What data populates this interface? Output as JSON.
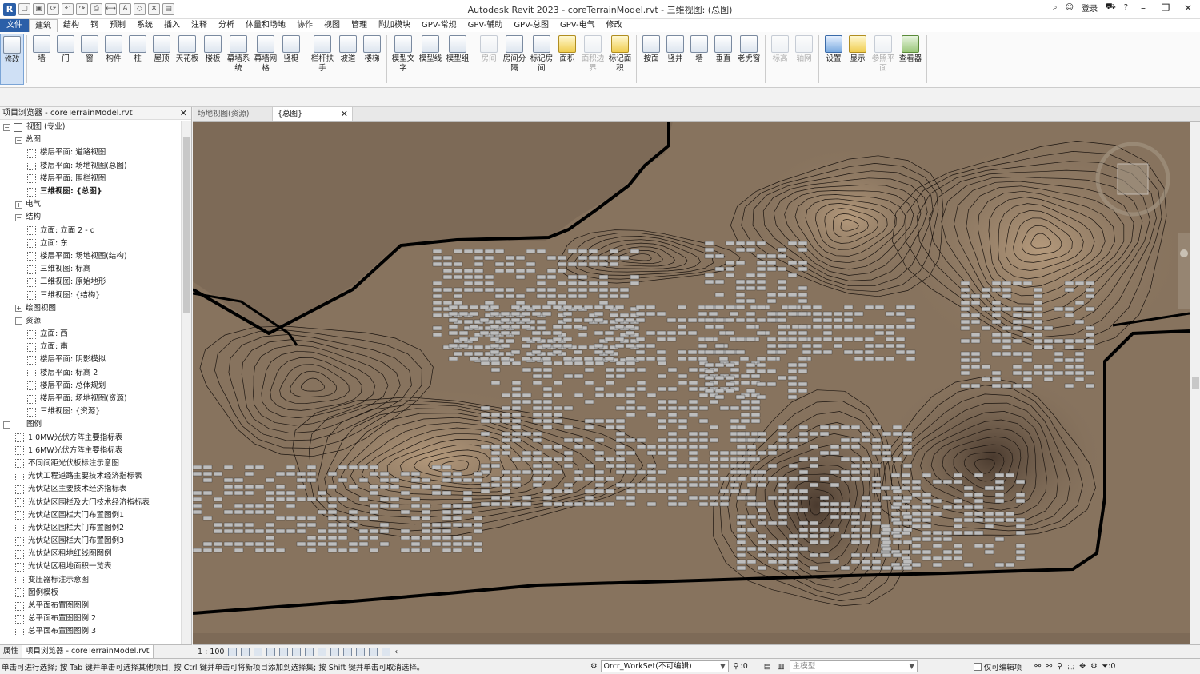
{
  "title": "Autodesk Revit 2023 - coreTerrainModel.rvt - 三维视图: (总图)",
  "title_right": {
    "login": "登录",
    "help": "?"
  },
  "menu_tabs": [
    "文件",
    "建筑",
    "结构",
    "钢",
    "预制",
    "系统",
    "插入",
    "注释",
    "分析",
    "体量和场地",
    "协作",
    "视图",
    "管理",
    "附加模块",
    "GPV-常规",
    "GPV-辅助",
    "GPV-总图",
    "GPV-电气",
    "修改"
  ],
  "ribbon": {
    "buttons": [
      {
        "label": "修改",
        "icon": "cursor-icon",
        "style": "sel"
      },
      {
        "label": "墙",
        "icon": "wall-icon"
      },
      {
        "label": "门",
        "icon": "door-icon"
      },
      {
        "label": "窗",
        "icon": "window-icon"
      },
      {
        "label": "构件",
        "icon": "component-icon"
      },
      {
        "label": "柱",
        "icon": "column-icon"
      },
      {
        "label": "屋顶",
        "icon": "roof-icon"
      },
      {
        "label": "天花板",
        "icon": "ceiling-icon"
      },
      {
        "label": "楼板",
        "icon": "floor-icon"
      },
      {
        "label": "幕墙系统",
        "icon": "curtain-system-icon"
      },
      {
        "label": "幕墙网格",
        "icon": "curtain-grid-icon"
      },
      {
        "label": "竖梃",
        "icon": "mullion-icon"
      },
      {
        "label": "栏杆扶手",
        "icon": "railing-icon"
      },
      {
        "label": "坡道",
        "icon": "ramp-icon"
      },
      {
        "label": "楼梯",
        "icon": "stair-icon"
      },
      {
        "label": "模型文字",
        "icon": "model-text-icon"
      },
      {
        "label": "模型线",
        "icon": "model-line-icon"
      },
      {
        "label": "模型组",
        "icon": "model-group-icon"
      },
      {
        "label": "房间",
        "icon": "room-icon",
        "style": "dim"
      },
      {
        "label": "房间分隔",
        "icon": "room-separator-icon"
      },
      {
        "label": "标记房间",
        "icon": "tag-room-icon"
      },
      {
        "label": "面积",
        "icon": "area-icon",
        "style": "y"
      },
      {
        "label": "面积边界",
        "icon": "area-boundary-icon",
        "style": "dim"
      },
      {
        "label": "标记面积",
        "icon": "tag-area-icon",
        "style": "y"
      },
      {
        "label": "按面",
        "icon": "by-face-icon"
      },
      {
        "label": "竖井",
        "icon": "shaft-icon"
      },
      {
        "label": "墙",
        "icon": "wall-opening-icon"
      },
      {
        "label": "垂直",
        "icon": "vertical-icon"
      },
      {
        "label": "老虎窗",
        "icon": "dormer-icon"
      },
      {
        "label": "标高",
        "icon": "level-icon",
        "style": "dim"
      },
      {
        "label": "轴网",
        "icon": "grid-icon",
        "style": "dim"
      },
      {
        "label": "设置",
        "icon": "set-icon",
        "style": "b"
      },
      {
        "label": "显示",
        "icon": "show-icon",
        "style": "y"
      },
      {
        "label": "参照平面",
        "icon": "ref-plane-icon",
        "style": "dim"
      },
      {
        "label": "查看器",
        "icon": "viewer-icon",
        "style": "g"
      }
    ]
  },
  "browser": {
    "title": "项目浏览器 - coreTerrainModel.rvt",
    "tree": [
      {
        "label": "视图 (专业)",
        "level": 0,
        "type": "root"
      },
      {
        "label": "总图",
        "level": 1,
        "type": "group"
      },
      {
        "label": "楼层平面: 道路视图",
        "level": 2,
        "type": "leaf"
      },
      {
        "label": "楼层平面: 场地视图(总图)",
        "level": 2,
        "type": "leaf"
      },
      {
        "label": "楼层平面: 围栏视图",
        "level": 2,
        "type": "leaf"
      },
      {
        "label": "三维视图: {总图}",
        "level": 2,
        "type": "leaf",
        "bold": true
      },
      {
        "label": "电气",
        "level": 1,
        "type": "group",
        "collapsed": true
      },
      {
        "label": "结构",
        "level": 1,
        "type": "group"
      },
      {
        "label": "立面: 立面 2 - d",
        "level": 2,
        "type": "leaf"
      },
      {
        "label": "立面: 东",
        "level": 2,
        "type": "leaf"
      },
      {
        "label": "楼层平面: 场地视图(结构)",
        "level": 2,
        "type": "leaf"
      },
      {
        "label": "三维视图: 标高",
        "level": 2,
        "type": "leaf"
      },
      {
        "label": "三维视图: 原始地形",
        "level": 2,
        "type": "leaf"
      },
      {
        "label": "三维视图: {结构}",
        "level": 2,
        "type": "leaf"
      },
      {
        "label": "绘图视图",
        "level": 1,
        "type": "group",
        "collapsed": true
      },
      {
        "label": "资源",
        "level": 1,
        "type": "group"
      },
      {
        "label": "立面: 西",
        "level": 2,
        "type": "leaf"
      },
      {
        "label": "立面: 南",
        "level": 2,
        "type": "leaf"
      },
      {
        "label": "楼层平面: 阴影模拟",
        "level": 2,
        "type": "leaf"
      },
      {
        "label": "楼层平面: 标高 2",
        "level": 2,
        "type": "leaf"
      },
      {
        "label": "楼层平面: 总体规划",
        "level": 2,
        "type": "leaf"
      },
      {
        "label": "楼层平面: 场地视图(资源)",
        "level": 2,
        "type": "leaf"
      },
      {
        "label": "三维视图: {资源}",
        "level": 2,
        "type": "leaf"
      },
      {
        "label": "图例",
        "level": 0,
        "type": "root"
      },
      {
        "label": "1.0MW光伏方阵主要指标表",
        "level": 1,
        "type": "leaf"
      },
      {
        "label": "1.6MW光伏方阵主要指标表",
        "level": 1,
        "type": "leaf"
      },
      {
        "label": "不同间距光伏板标注示意图",
        "level": 1,
        "type": "leaf"
      },
      {
        "label": "光伏工程道路主要技术经济指标表",
        "level": 1,
        "type": "leaf"
      },
      {
        "label": "光伏站区主要技术经济指标表",
        "level": 1,
        "type": "leaf"
      },
      {
        "label": "光伏站区围栏及大门技术经济指标表",
        "level": 1,
        "type": "leaf"
      },
      {
        "label": "光伏站区围栏大门布置图例1",
        "level": 1,
        "type": "leaf"
      },
      {
        "label": "光伏站区围栏大门布置图例2",
        "level": 1,
        "type": "leaf"
      },
      {
        "label": "光伏站区围栏大门布置图例3",
        "level": 1,
        "type": "leaf"
      },
      {
        "label": "光伏站区租地红线图图例",
        "level": 1,
        "type": "leaf"
      },
      {
        "label": "光伏站区租地面积一览表",
        "level": 1,
        "type": "leaf"
      },
      {
        "label": "变压器标注示意图",
        "level": 1,
        "type": "leaf"
      },
      {
        "label": "图例模板",
        "level": 1,
        "type": "leaf"
      },
      {
        "label": "总平面布置图图例",
        "level": 1,
        "type": "leaf"
      },
      {
        "label": "总平面布置图图例 2",
        "level": 1,
        "type": "leaf"
      },
      {
        "label": "总平面布置图图例 3",
        "level": 1,
        "type": "leaf"
      }
    ]
  },
  "bottom_tabs": [
    "属性",
    "项目浏览器 - coreTerrainModel.rvt"
  ],
  "doc_tabs": [
    {
      "label": "场地视图(资源)",
      "active": false
    },
    {
      "label": "{总图}",
      "active": true
    }
  ],
  "viewbar": {
    "scale": "1 : 100"
  },
  "status": {
    "message": "单击可进行选择; 按 Tab 键并单击可选择其他项目; 按 Ctrl 键并单击可将新项目添加到选择集; 按 Shift 键并单击可取消选择。",
    "workset": "Orcr_WorkSet(不可编辑)",
    "count": ":0",
    "main_model": "主模型",
    "editable_only": "仅可编辑项",
    "filter_count": ":0"
  },
  "colors": {
    "terrain": "#87735e",
    "terrain_dark": "#5b4a3c",
    "terrain_light": "#b59a7c",
    "panel": "#bdbdbd",
    "boundary": "#000000",
    "accent": "#2b5fa8"
  }
}
